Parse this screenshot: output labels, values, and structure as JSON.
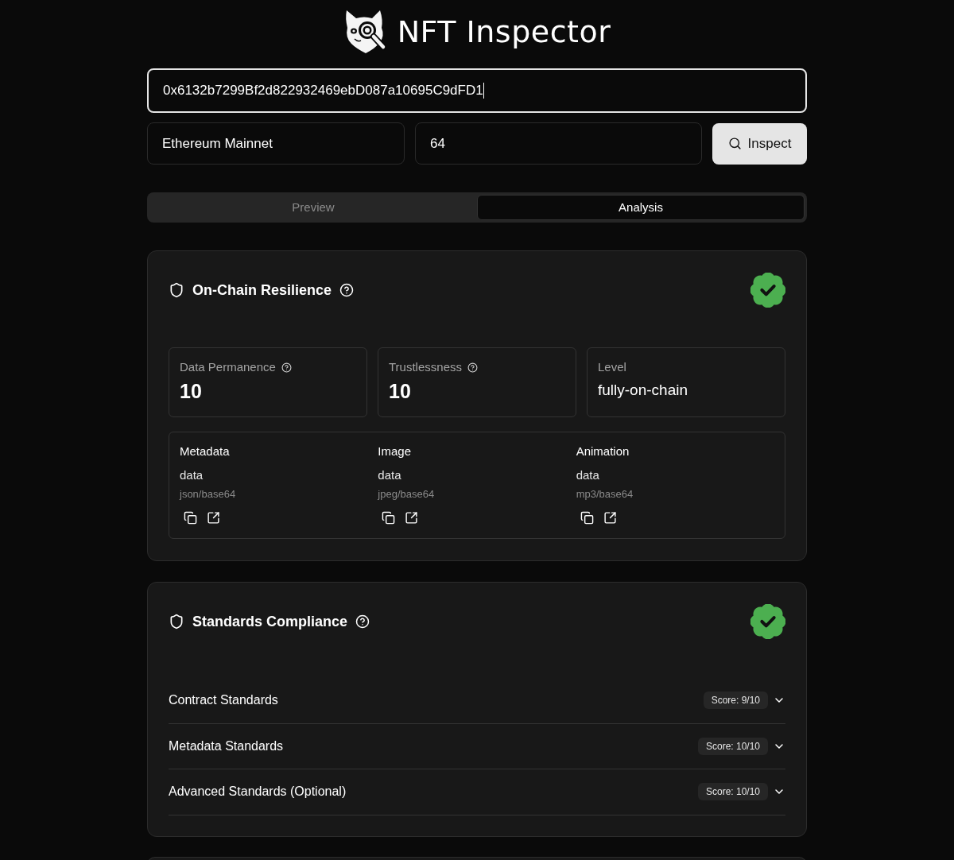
{
  "header": {
    "title": "NFT Inspector"
  },
  "search": {
    "address": {
      "value": "0x6132b7299Bf2d822932469ebD087a10695C9dFD1",
      "focused": true
    },
    "network": {
      "value": "Ethereum Mainnet"
    },
    "token_id": {
      "value": "64"
    },
    "button": {
      "label": "Inspect"
    }
  },
  "tabs": [
    {
      "label": "Preview",
      "selected": false
    },
    {
      "label": "Analysis",
      "selected": true
    }
  ],
  "sections": [
    {
      "kind": "resilience",
      "title": "On-Chain Resilience",
      "verified": true,
      "metrics": [
        {
          "kind": "score",
          "label": "Data Permanence",
          "value": "10",
          "help": true
        },
        {
          "kind": "score",
          "label": "Trustlessness",
          "value": "10",
          "help": true
        },
        {
          "kind": "text",
          "label": "Level",
          "value": "fully-on-chain",
          "help": false
        }
      ],
      "assets": [
        {
          "label": "Metadata",
          "storage": "data",
          "format": "json/base64"
        },
        {
          "label": "Image",
          "storage": "data",
          "format": "jpeg/base64"
        },
        {
          "label": "Animation",
          "storage": "data",
          "format": "mp3/base64"
        }
      ]
    },
    {
      "kind": "standards",
      "title": "Standards Compliance",
      "verified": true,
      "groups": [
        {
          "title": "Contract Standards",
          "score": "Score: 9/10",
          "expanded": false
        },
        {
          "title": "Metadata Standards",
          "score": "Score: 10/10",
          "expanded": false
        },
        {
          "title": "Advanced Standards (Optional)",
          "score": "Score: 10/10",
          "expanded": false
        }
      ]
    }
  ]
}
